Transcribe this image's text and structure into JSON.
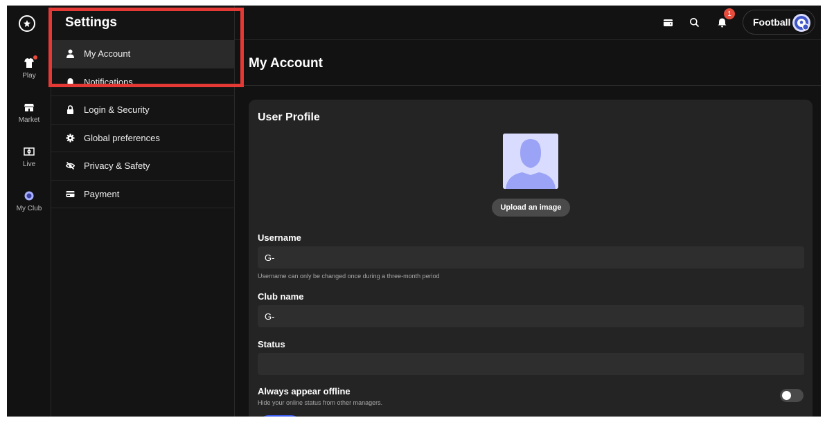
{
  "rail": {
    "items": [
      {
        "label": "Play"
      },
      {
        "label": "Market"
      },
      {
        "label": "Live"
      },
      {
        "label": "My Club"
      }
    ]
  },
  "settings": {
    "title": "Settings",
    "menu": [
      {
        "label": "My Account",
        "icon": "user-icon",
        "active": true
      },
      {
        "label": "Notifications",
        "icon": "bell-icon"
      },
      {
        "label": "Login & Security",
        "icon": "lock-icon"
      },
      {
        "label": "Global preferences",
        "icon": "gear-icon"
      },
      {
        "label": "Privacy & Safety",
        "icon": "eye-slash-icon"
      },
      {
        "label": "Payment",
        "icon": "card-icon"
      }
    ]
  },
  "topbar": {
    "notification_count": "1",
    "sport": "Football"
  },
  "main": {
    "title": "My Account",
    "card_title": "User Profile",
    "upload_label": "Upload an image",
    "username": {
      "label": "Username",
      "value": "G-",
      "hint": "Username can only be changed once during a three-month period"
    },
    "club_name": {
      "label": "Club name",
      "value": "G-"
    },
    "status": {
      "label": "Status",
      "value": ""
    },
    "offline": {
      "label": "Always appear offline",
      "hint": "Hide your online status from other managers."
    }
  },
  "colors": {
    "background": "#121212",
    "card": "#242424",
    "accent": "#3a5cf0",
    "highlight": "#e53935",
    "badge": "#e74c3c"
  }
}
